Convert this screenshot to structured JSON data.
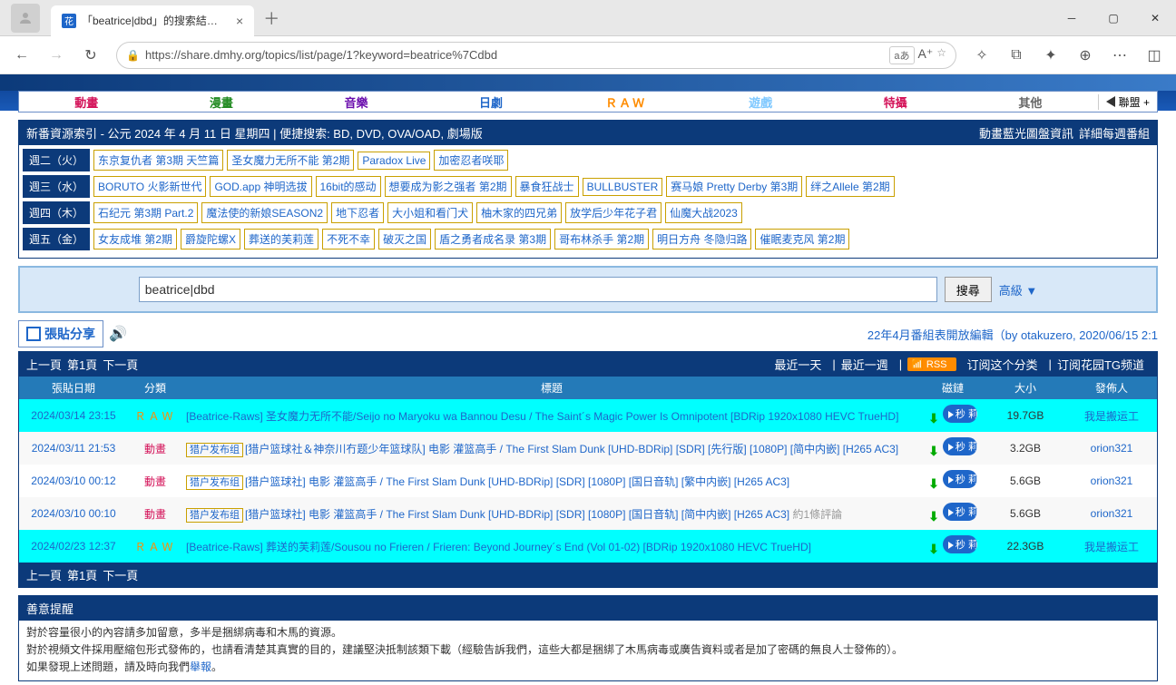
{
  "browser": {
    "tab_title": "「beatrice|dbd」的搜索結果 - 動",
    "url": "https://share.dmhy.org/topics/list/page/1?keyword=beatrice%7Cdbd",
    "url_lang_badge": "aあ"
  },
  "nav": {
    "anime": "動畫",
    "manga": "漫畫",
    "music": "音樂",
    "drama": "日劇",
    "raw": "ＲＡＷ",
    "game": "遊戲",
    "toku": "特攝",
    "other": "其他",
    "alliance": "聯盟 +"
  },
  "index_header": {
    "left": "新番資源索引 - 公元 2024 年 4 月 11 日 星期四 | 便捷搜索: BD, DVD, OVA/OAD, 劇場版",
    "right1": "動畫藍光圖盤資訊",
    "right2": "詳細每週番組"
  },
  "schedule": [
    {
      "day": "週二（火）",
      "items": [
        "东京复仇者 第3期 天竺篇",
        "圣女魔力无所不能 第2期",
        "Paradox Live",
        "加密忍者咲耶"
      ]
    },
    {
      "day": "週三（水）",
      "items": [
        "BORUTO 火影新世代",
        "GOD.app 神明选拔",
        "16bit的感动",
        "想要成为影之强者 第2期",
        "暴食狂战士",
        "BULLBUSTER",
        "赛马娘 Pretty Derby 第3期",
        "绊之Allele 第2期"
      ]
    },
    {
      "day": "週四（木）",
      "items": [
        "石纪元 第3期 Part.2",
        "魔法使的新娘SEASON2",
        "地下忍者",
        "大小姐和看门犬",
        "柚木家的四兄弟",
        "放学后少年花子君",
        "仙魔大战2023"
      ]
    },
    {
      "day": "週五（金）",
      "items": [
        "女友成堆 第2期",
        "爵旋陀螺X",
        "葬送的芙莉莲",
        "不死不幸",
        "破灭之国",
        "盾之勇者成名录 第3期",
        "哥布林杀手 第2期",
        "明日方舟 冬隐归路",
        "催眠麦克风 第2期"
      ]
    }
  ],
  "search": {
    "value": "beatrice|dbd",
    "button": "搜尋",
    "advanced": "高級 ▼"
  },
  "post": {
    "share": "張貼分享",
    "right_notice": "22年4月番組表開放編輯（by otakuzero, 2020/06/15 2:1"
  },
  "pager": {
    "prev": "上一頁",
    "curr": "第1頁",
    "next": "下一頁",
    "recent_day": "最近一天",
    "recent_week": "最近一週",
    "rss": "RSS",
    "sub_cat": "订阅这个分类",
    "sub_tg": "订阅花园TG频道"
  },
  "thead": {
    "date": "張貼日期",
    "cat": "分類",
    "title": "標題",
    "mag": "磁鏈",
    "size": "大小",
    "pub": "發佈人"
  },
  "rows": [
    {
      "date": "2024/03/14 23:15",
      "cat": "ＲＡＷ",
      "cat_cls": "cat-raw",
      "hi": true,
      "title": "[Beatrice-Raws] 圣女魔力无所不能/Seijo no Maryoku wa Bannou Desu / The Saint´s Magic Power Is Omnipotent [BDRip 1920x1080 HEVC TrueHD]",
      "size": "19.7GB",
      "pub": "我是搬运工"
    },
    {
      "date": "2024/03/11 21:53",
      "cat": "動畫",
      "cat_cls": "cat-anime",
      "hi": false,
      "tag": "猎户发布组",
      "title": "[猎户篮球社＆神奈川冇题少年篮球队] 电影 灌篮高手 / The First Slam Dunk [UHD-BDRip] [SDR] [先行版] [1080P] [简中内嵌] [H265 AC3]",
      "size": "3.2GB",
      "pub": "orion321"
    },
    {
      "date": "2024/03/10 00:12",
      "cat": "動畫",
      "cat_cls": "cat-anime",
      "hi": false,
      "tag": "猎户发布组",
      "title": "[猎户篮球社] 电影 灌篮高手 / The First Slam Dunk [UHD-BDRip] [SDR] [1080P] [国日音轨] [繁中内嵌] [H265 AC3]",
      "size": "5.6GB",
      "pub": "orion321"
    },
    {
      "date": "2024/03/10 00:10",
      "cat": "動畫",
      "cat_cls": "cat-anime",
      "hi": false,
      "tag": "猎户发布组",
      "title": "[猎户篮球社] 电影 灌篮高手 / The First Slam Dunk [UHD-BDRip] [SDR] [1080P] [国日音轨] [简中内嵌] [H265 AC3]",
      "comment": "約1條評論",
      "size": "5.6GB",
      "pub": "orion321"
    },
    {
      "date": "2024/02/23 12:37",
      "cat": "ＲＡＷ",
      "cat_cls": "cat-raw",
      "hi": true,
      "title": "[Beatrice-Raws] 葬送的芙莉莲/Sousou no Frieren / Frieren: Beyond Journey´s End (Vol 01-02) [BDRip 1920x1080 HEVC TrueHD]",
      "size": "22.3GB",
      "pub": "我是搬运工"
    }
  ],
  "sec_label": "秒 莉",
  "reminder": {
    "title": "善意提醒",
    "l1": "對於容量很小的內容請多加留意，多半是捆綁病毒和木馬的資源。",
    "l2a": "對於視頻文件採用壓縮包形式發佈的，也請看清楚其真實的目的，建議堅決抵制該類下載（經驗告訴我們，這些大都是捆綁了木馬病毒或廣告資料或者是加了密碼的無良人士發佈的）。",
    "l3a": "如果發現上述問題，請及時向我們",
    "l3b": "舉報",
    "l3c": "。"
  }
}
